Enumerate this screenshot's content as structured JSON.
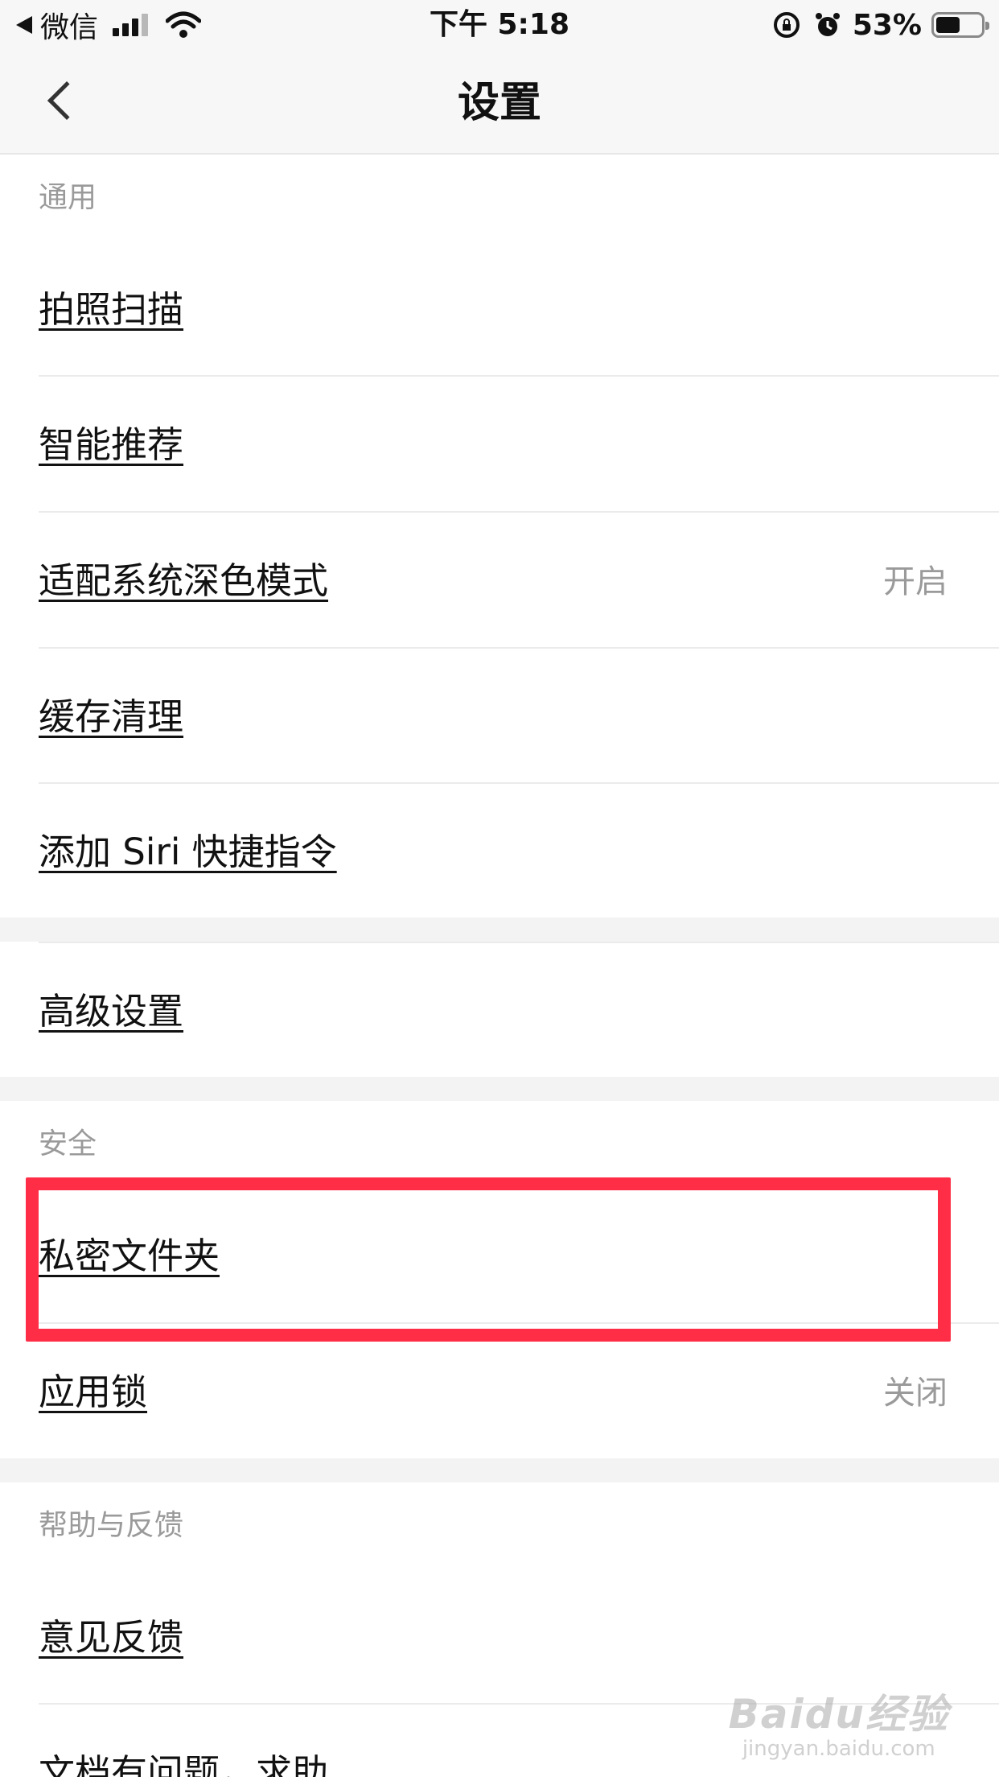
{
  "status_bar": {
    "back_app": "微信",
    "time": "下午 5:18",
    "battery_percent_text": "53%",
    "battery_level": 0.53
  },
  "nav": {
    "title": "设置"
  },
  "sections": {
    "general": {
      "header": "通用",
      "items": [
        {
          "label": "拍照扫描",
          "value": ""
        },
        {
          "label": "智能推荐",
          "value": ""
        },
        {
          "label": "适配系统深色模式",
          "value": "开启"
        },
        {
          "label": "缓存清理",
          "value": ""
        },
        {
          "label": "添加 Siri 快捷指令",
          "value": ""
        }
      ]
    },
    "advanced": {
      "items": [
        {
          "label": "高级设置",
          "value": ""
        }
      ]
    },
    "security": {
      "header": "安全",
      "items": [
        {
          "label": "私密文件夹",
          "value": ""
        },
        {
          "label": "应用锁",
          "value": "关闭"
        }
      ]
    },
    "help": {
      "header": "帮助与反馈",
      "items": [
        {
          "label": "意见反馈",
          "value": ""
        },
        {
          "label": "文档有问题，求助",
          "value": ""
        }
      ]
    }
  },
  "annotation": {
    "highlight_color": "#ff2d46",
    "highlighted_item": "私密文件夹"
  },
  "watermark": {
    "logo": "Baidu经验",
    "url": "jingyan.baidu.com"
  }
}
